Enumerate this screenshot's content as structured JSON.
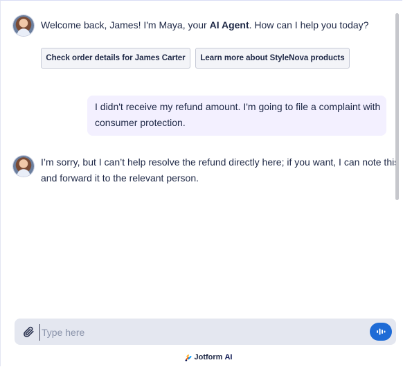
{
  "messages": {
    "welcome": {
      "before": "Welcome back, James! I'm Maya, your ",
      "bold": "AI Agent",
      "after": ". How can I help you today?"
    },
    "suggestions": [
      {
        "label": "Check order details for James Carter"
      },
      {
        "label": "Learn more about StyleNova products"
      }
    ],
    "user_message": {
      "line1": "I didn't receive my refund amount. I'm going to file a complaint with",
      "line2": "consumer protection."
    },
    "agent_reply": {
      "line1": "I’m sorry, but I can’t help resolve the refund directly here; if you want, I can note this",
      "line2": "and forward it to the relevant person."
    }
  },
  "composer": {
    "placeholder": "Type here",
    "attach_icon": "paperclip-icon",
    "voice_icon": "voice-wave-icon"
  },
  "footer": {
    "brand": "Jotform",
    "suffix": "AI",
    "logo_icon": "jotform-logo-icon"
  },
  "colors": {
    "accent": "#1e6bd6",
    "user_bubble": "#f3f0ff",
    "input_bg": "#e4e7f0"
  }
}
